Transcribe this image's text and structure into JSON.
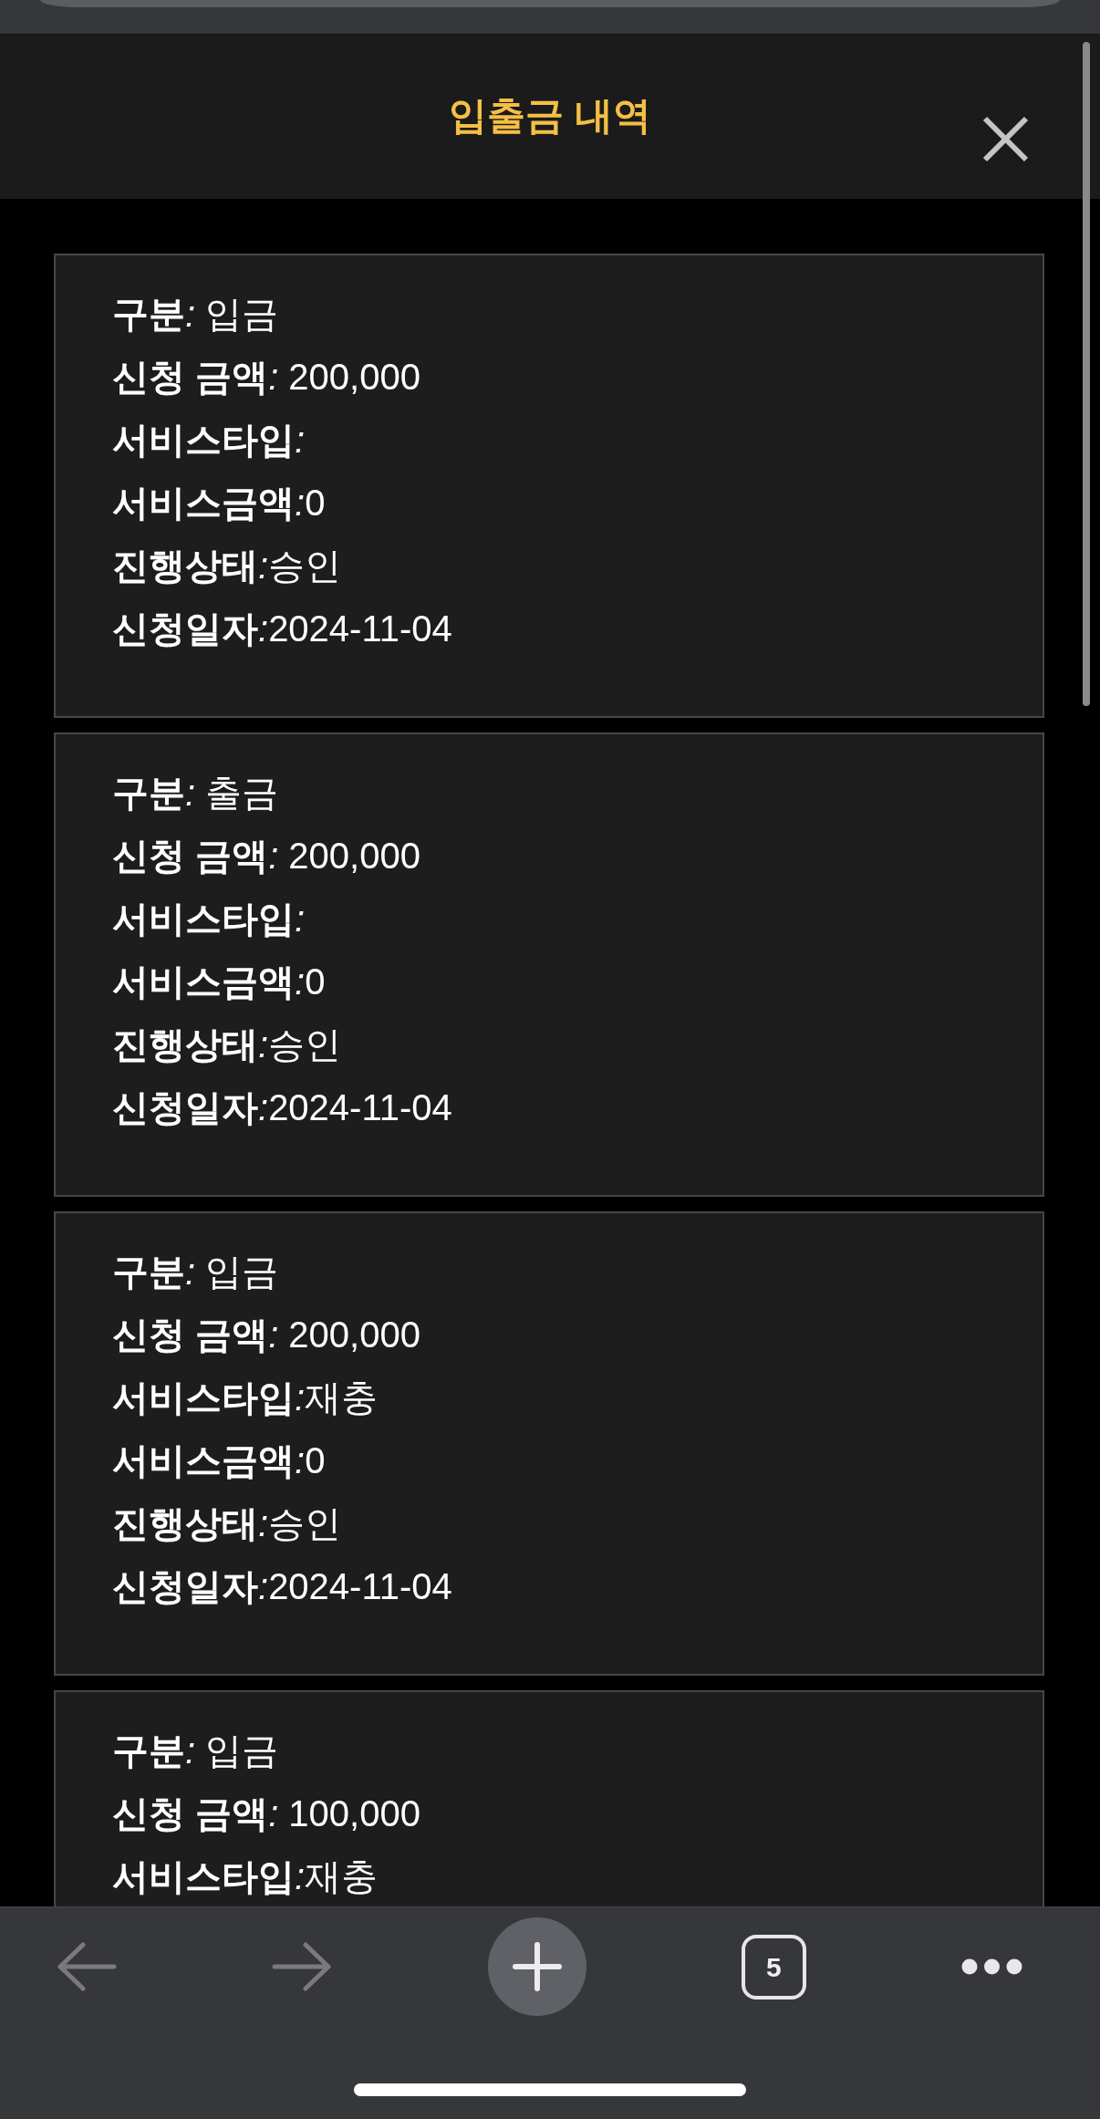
{
  "dialog": {
    "title": "입출금 내역"
  },
  "records": [
    {
      "fields": [
        {
          "label": "구분",
          "separator": ": ",
          "value": "입금"
        },
        {
          "label": "신청 금액",
          "separator": ": ",
          "value": "200,000"
        },
        {
          "label": "서비스타입",
          "separator": ":"
        },
        {
          "label": "서비스금액",
          "separator": ":",
          "value": "0"
        },
        {
          "label": "진행상태",
          "separator": ":",
          "value": "승인"
        },
        {
          "label": "신청일자",
          "separator": ":",
          "value": "2024-11-04"
        }
      ]
    },
    {
      "fields": [
        {
          "label": "구분",
          "separator": ": ",
          "value": "출금"
        },
        {
          "label": "신청 금액",
          "separator": ": ",
          "value": "200,000"
        },
        {
          "label": "서비스타입",
          "separator": ":"
        },
        {
          "label": "서비스금액",
          "separator": ":",
          "value": "0"
        },
        {
          "label": "진행상태",
          "separator": ":",
          "value": "승인"
        },
        {
          "label": "신청일자",
          "separator": ":",
          "value": "2024-11-04"
        }
      ]
    },
    {
      "fields": [
        {
          "label": "구분",
          "separator": ": ",
          "value": "입금"
        },
        {
          "label": "신청 금액",
          "separator": ": ",
          "value": "200,000"
        },
        {
          "label": "서비스타입",
          "separator": ":",
          "value": "재충"
        },
        {
          "label": "서비스금액",
          "separator": ":",
          "value": "0"
        },
        {
          "label": "진행상태",
          "separator": ":",
          "value": "승인"
        },
        {
          "label": "신청일자",
          "separator": ":",
          "value": "2024-11-04"
        }
      ]
    },
    {
      "fields": [
        {
          "label": "구분",
          "separator": ": ",
          "value": "입금"
        },
        {
          "label": "신청 금액",
          "separator": ": ",
          "value": "100,000"
        },
        {
          "label": "서비스타입",
          "separator": ":",
          "value": "재충"
        }
      ]
    }
  ],
  "toolbar": {
    "buttons": [
      {
        "kind": "back",
        "disabled": true
      },
      {
        "kind": "forward",
        "disabled": true
      },
      {
        "kind": "add"
      },
      {
        "kind": "tabs",
        "count": "5"
      },
      {
        "kind": "more"
      }
    ]
  }
}
